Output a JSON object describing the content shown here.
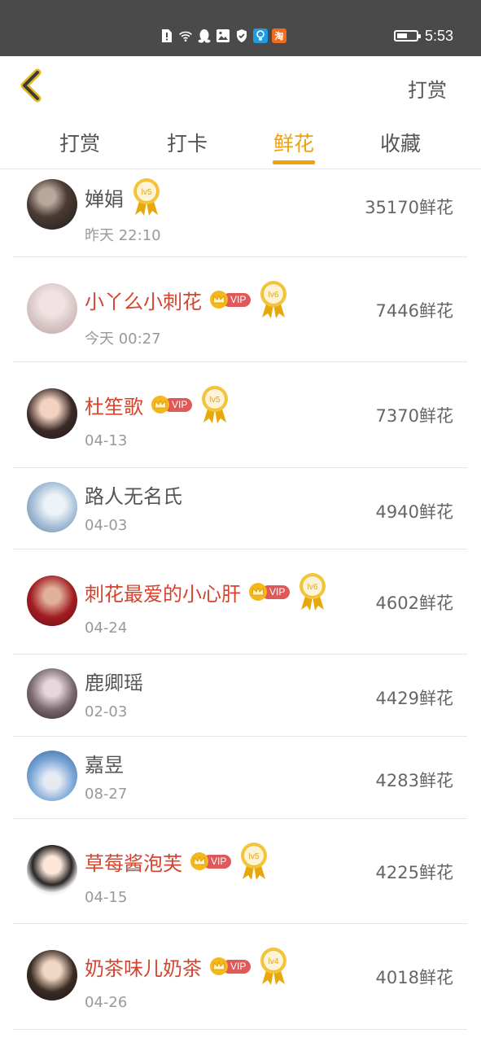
{
  "status_bar": {
    "time": "5:53",
    "icons": [
      "alert-icon",
      "wifi-icon",
      "qq-icon",
      "gallery-icon",
      "shield-icon",
      "bulb-icon",
      "taobao-icon"
    ],
    "taobao_label": "淘",
    "battery_level": 0.55
  },
  "header": {
    "action_label": "打赏"
  },
  "tabs": [
    {
      "label": "打赏",
      "active": false
    },
    {
      "label": "打卡",
      "active": false
    },
    {
      "label": "鲜花",
      "active": true
    },
    {
      "label": "收藏",
      "active": false
    }
  ],
  "vip_label": "VIP",
  "colors": {
    "accent": "#f0a10b",
    "vip_name": "#d4442e",
    "vip_badge": "#e05858",
    "gold": "#f5b81b"
  },
  "entries": [
    {
      "name": "婵娟",
      "date": "昨天 22:10",
      "amount": "35170鲜花",
      "vip": false,
      "level": "lv5"
    },
    {
      "name": "小丫么小刺花",
      "date": "今天 00:27",
      "amount": "7446鲜花",
      "vip": true,
      "level": "lv6"
    },
    {
      "name": "杜笙歌",
      "date": "04-13",
      "amount": "7370鲜花",
      "vip": true,
      "level": "lv5"
    },
    {
      "name": "路人无名氏",
      "date": "04-03",
      "amount": "4940鲜花",
      "vip": false,
      "level": ""
    },
    {
      "name": "刺花最爱的小心肝",
      "date": "04-24",
      "amount": "4602鲜花",
      "vip": true,
      "level": "lv6"
    },
    {
      "name": "鹿卿瑶",
      "date": "02-03",
      "amount": "4429鲜花",
      "vip": false,
      "level": ""
    },
    {
      "name": "嘉昱",
      "date": "08-27",
      "amount": "4283鲜花",
      "vip": false,
      "level": ""
    },
    {
      "name": "草莓酱泡芙",
      "date": "04-15",
      "amount": "4225鲜花",
      "vip": true,
      "level": "lv5"
    },
    {
      "name": "奶茶味儿奶茶",
      "date": "04-26",
      "amount": "4018鲜花",
      "vip": true,
      "level": "lv4"
    }
  ]
}
